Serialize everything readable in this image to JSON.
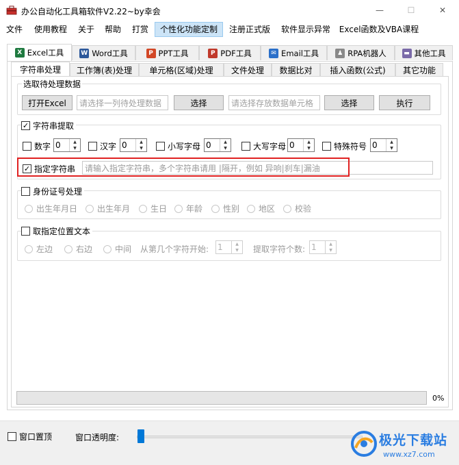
{
  "window": {
    "title": "办公自动化工具箱软件V2.22~by幸会",
    "minimize_glyph": "—",
    "maximize_glyph": "☐",
    "close_glyph": "✕"
  },
  "menu": {
    "items": [
      "文件",
      "使用教程",
      "关于",
      "帮助",
      "打赏",
      "个性化功能定制",
      "注册正式版",
      "软件显示异常",
      "Excel函数及VBA课程"
    ],
    "active_index": 5
  },
  "tool_tabs": [
    {
      "label": "Excel工具",
      "icon": "excel-icon",
      "icon_text": "X",
      "color": "#1f7a40"
    },
    {
      "label": "Word工具",
      "icon": "word-icon",
      "icon_text": "W",
      "color": "#2b579a"
    },
    {
      "label": "PPT工具",
      "icon": "ppt-icon",
      "icon_text": "P",
      "color": "#d24726"
    },
    {
      "label": "PDF工具",
      "icon": "pdf-icon",
      "icon_text": "P",
      "color": "#c0392b"
    },
    {
      "label": "Email工具",
      "icon": "email-icon",
      "icon_text": "✉",
      "color": "#2a6fc9"
    },
    {
      "label": "RPA机器人",
      "icon": "robot-icon",
      "icon_text": "♟",
      "color": "#888888"
    },
    {
      "label": "其他工具",
      "icon": "folder-icon",
      "icon_text": "▬",
      "color": "#7a6aa8"
    }
  ],
  "sub_tabs": [
    "字符串处理",
    "工作簿(表)处理",
    "单元格(区域)处理",
    "文件处理",
    "数据比对",
    "插入函数(公式)",
    "其它功能"
  ],
  "select_group": {
    "title": "选取待处理数据",
    "open_excel": "打开Excel",
    "source_placeholder": "请选择一列待处理数据",
    "select1": "选择",
    "target_placeholder": "请选择存放数据单元格",
    "select2": "选择",
    "execute": "执行"
  },
  "extract_group": {
    "title": "字符串提取",
    "checked": true,
    "options": [
      {
        "label": "数字",
        "value": "0"
      },
      {
        "label": "汉字",
        "value": "0"
      },
      {
        "label": "小写字母",
        "value": "0"
      },
      {
        "label": "大写字母",
        "value": "0"
      },
      {
        "label": "特殊符号",
        "value": "0"
      }
    ],
    "check_glyph": "✓"
  },
  "specified": {
    "label": "指定字符串",
    "checked": true,
    "placeholder": "请输入指定字符串，多个字符串请用 |隔开，例如 异响|刹车|漏油"
  },
  "id_group": {
    "title": "身份证号处理",
    "checked": false,
    "options": [
      "出生年月日",
      "出生年月",
      "生日",
      "年龄",
      "性别",
      "地区",
      "校验"
    ]
  },
  "position_group": {
    "title": "取指定位置文本",
    "checked": false,
    "options": [
      "左边",
      "右边",
      "中间"
    ],
    "start_label": "从第几个字符开始:",
    "start_value": "1",
    "count_label": "提取字符个数:",
    "count_value": "1"
  },
  "progress": {
    "value": 0,
    "text": "0%"
  },
  "bottom": {
    "pin_label": "窗口置顶",
    "opacity_label": "窗口透明度:",
    "opacity_value": 0
  },
  "watermark": {
    "title": "极光下载站",
    "url": "www.xz7.com"
  },
  "colors": {
    "accent": "#0078d7",
    "highlight": "#e02020",
    "menu_active": "#cce4f7"
  }
}
